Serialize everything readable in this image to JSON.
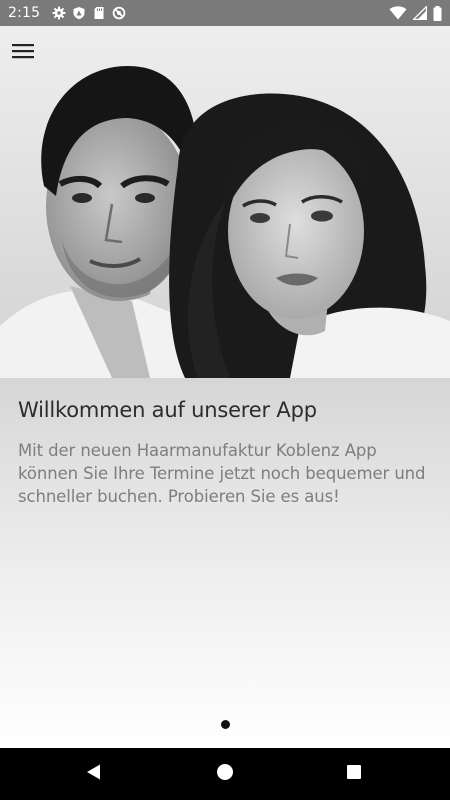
{
  "status_bar": {
    "time": "2:15",
    "left_icons": [
      "gear-icon",
      "shield-icon",
      "sd-card-icon",
      "no-sync-icon"
    ],
    "right_icons": [
      "wifi-icon",
      "cell-signal-icon",
      "battery-icon"
    ]
  },
  "header": {
    "menu_icon": "hamburger-menu-icon"
  },
  "hero": {
    "image": "black-and-white portrait photo"
  },
  "main": {
    "title": "Willkommen auf unserer App",
    "description": "Mit der neuen Haarmanufaktur Koblenz App können Sie Ihre Termine jetzt noch bequemer und schneller buchen. Probieren Sie es aus!",
    "page_indicator": {
      "current": 1,
      "total": 1
    }
  },
  "navigation_bar": {
    "buttons": [
      "back-icon",
      "home-icon",
      "recents-icon"
    ]
  },
  "colors": {
    "status_bar": "#7a7a7a",
    "title_text": "#2c2c2c",
    "body_text": "#7e7e7e",
    "nav_bar": "#000000"
  }
}
